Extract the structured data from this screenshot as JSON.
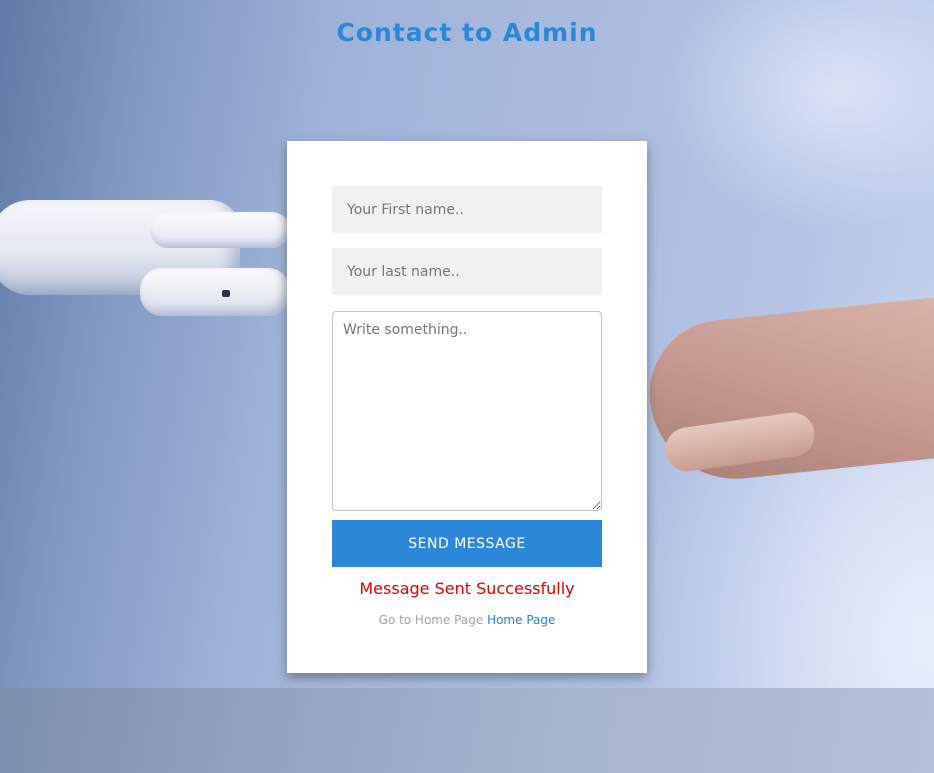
{
  "header": {
    "title": "Contact to Admin"
  },
  "form": {
    "first_name_placeholder": "Your First name..",
    "last_name_placeholder": "Your last name..",
    "message_placeholder": "Write something..",
    "send_button_label": "SEND MESSAGE",
    "status_message": "Message Sent Successfully",
    "home_prompt": "Go to Home Page",
    "home_link_label": "Home Page"
  },
  "theme": {
    "accent": "#2d87d8",
    "status_color": "#e00000"
  }
}
